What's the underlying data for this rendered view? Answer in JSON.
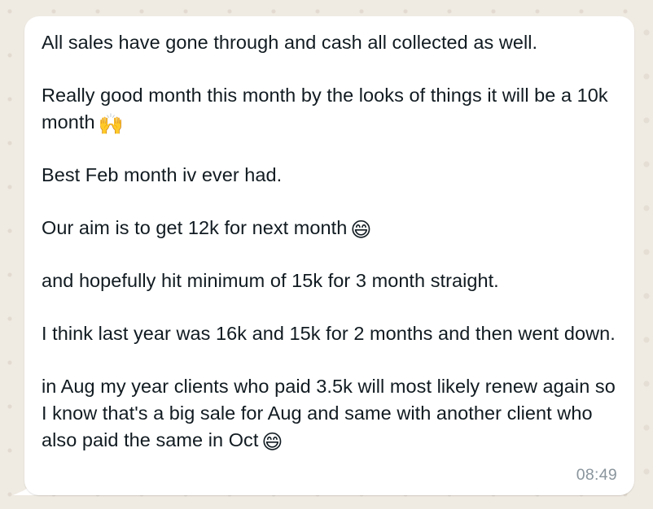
{
  "message": {
    "paragraphs": [
      {
        "text": "All sales have gone through and cash all collected as well.",
        "emoji": ""
      },
      {
        "text": "Really good month this month by the looks of things it will be a 10k month",
        "emoji": "🙌"
      },
      {
        "text": "Best Feb month iv ever had.",
        "emoji": ""
      },
      {
        "text": "Our aim is to get 12k for next month",
        "emoji": "😄"
      },
      {
        "text": "and hopefully hit minimum of 15k for 3 month straight.",
        "emoji": ""
      },
      {
        "text": "I think last year was 16k and 15k for 2 months and then went down.",
        "emoji": ""
      },
      {
        "text": "in Aug my year clients who paid 3.5k will most likely renew again so I know that's a big sale for Aug and same with another client who also paid the same in Oct",
        "emoji": "😄"
      }
    ],
    "timestamp": "08:49"
  },
  "colors": {
    "wallpaper": "#efeae2",
    "bubble": "#ffffff",
    "text": "#111b21",
    "timestamp": "#8a959d"
  }
}
